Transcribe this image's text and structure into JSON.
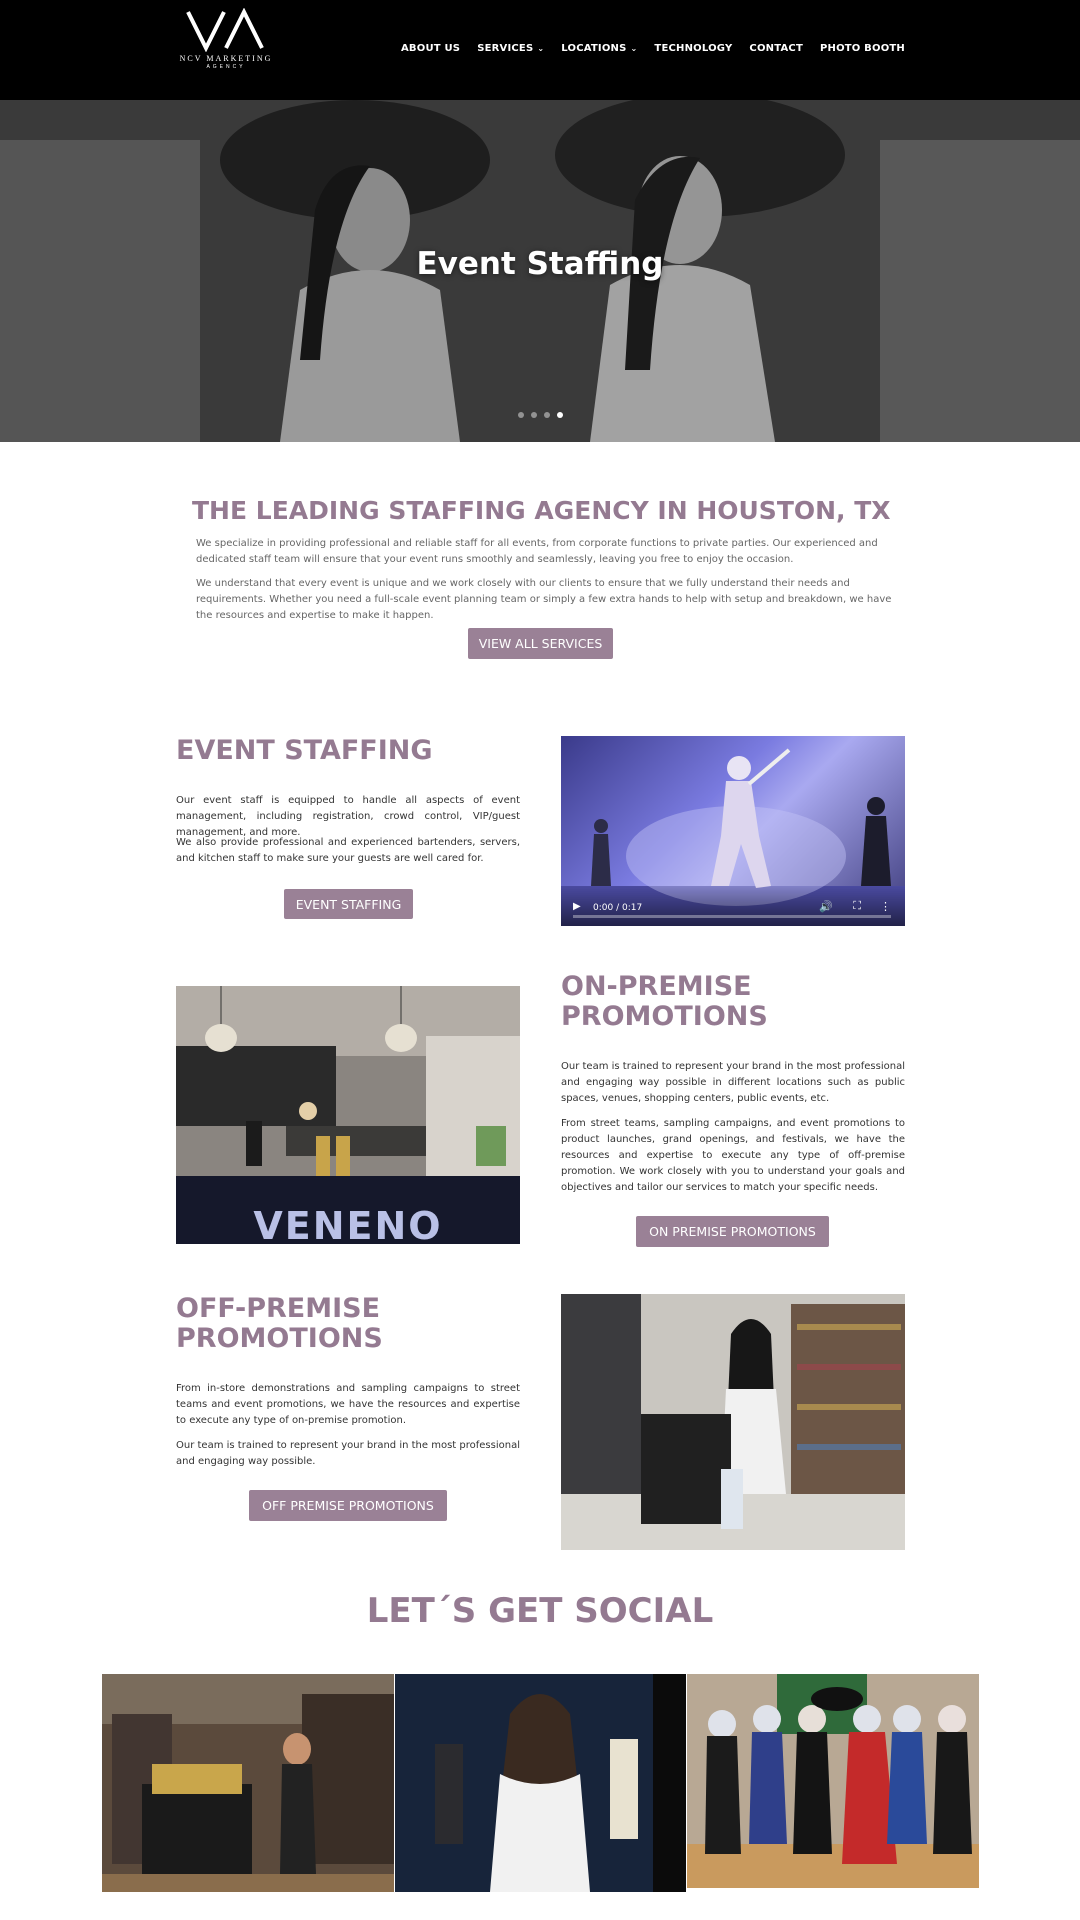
{
  "header": {
    "logo_text": "NCV MARKETING",
    "logo_sub": "AGENCY",
    "nav": [
      {
        "label": "ABOUT US",
        "has_dropdown": false
      },
      {
        "label": "SERVICES",
        "has_dropdown": true
      },
      {
        "label": "LOCATIONS",
        "has_dropdown": true
      },
      {
        "label": "TECHNOLOGY",
        "has_dropdown": false
      },
      {
        "label": "CONTACT",
        "has_dropdown": false
      },
      {
        "label": "PHOTO BOOTH",
        "has_dropdown": false
      }
    ]
  },
  "hero": {
    "title": "Event Staffing",
    "slider_count": 4,
    "active_slide": 4
  },
  "intro": {
    "title": "THE LEADING STAFFING AGENCY IN HOUSTON, TX",
    "paragraph1": "We specialize in providing professional and reliable staff for all events, from corporate functions to private parties. Our experienced and dedicated staff team will ensure that your event runs smoothly and seamlessly, leaving you free to enjoy the occasion.",
    "paragraph2": "We understand that every event is unique and we work closely with our clients to ensure that we fully understand their needs and requirements. Whether you need a full-scale event planning team or simply a few extra hands to help with setup and breakdown, we have the resources and expertise to make it happen.",
    "button": "VIEW ALL SERVICES"
  },
  "event_staffing": {
    "title": "EVENT STAFFING",
    "paragraph1": "Our event staff is equipped to handle all aspects of event management, including registration, crowd control, VIP/guest management, and more.",
    "paragraph2": "We also provide professional and experienced bartenders, servers, and kitchen staff to make sure your guests are well cared for.",
    "button": "EVENT STAFFING",
    "video_time": "0:00 / 0:17",
    "video_progress": 0
  },
  "on_premise": {
    "title_line1": "ON-PREMISE",
    "title_line2": "PROMOTIONS",
    "paragraph1": "Our team is trained to represent your brand in the most professional and engaging way possible in different locations such as public spaces, venues, shopping centers, public events, etc.",
    "paragraph2": "From street teams, sampling campaigns, and event promotions to product launches, grand openings, and festivals, we have the resources and expertise to execute any type of off-premise promotion. We work closely with you to understand your goals and objectives and tailor our services to match your specific needs.",
    "button": "ON PREMISE PROMOTIONS",
    "photo_banner": "VENENO"
  },
  "off_premise": {
    "title_line1": "OFF-PREMISE",
    "title_line2": "PROMOTIONS",
    "paragraph1": "From in-store demonstrations and sampling campaigns to street teams and event promotions, we have the resources and expertise to execute any type of on-premise promotion.",
    "paragraph2": "Our team is trained to represent your brand in the most professional and engaging way possible.",
    "button": "OFF PREMISE PROMOTIONS"
  },
  "social": {
    "title": "LET´S GET SOCIAL"
  },
  "icons": {
    "play": "play-icon",
    "volume": "volume-icon",
    "fullscreen": "fullscreen-icon",
    "more": "more-vertical-icon",
    "chevron": "chevron-down-icon"
  },
  "colors": {
    "accent": "#947a91",
    "button": "#9a8196",
    "header_bg": "#000000"
  }
}
